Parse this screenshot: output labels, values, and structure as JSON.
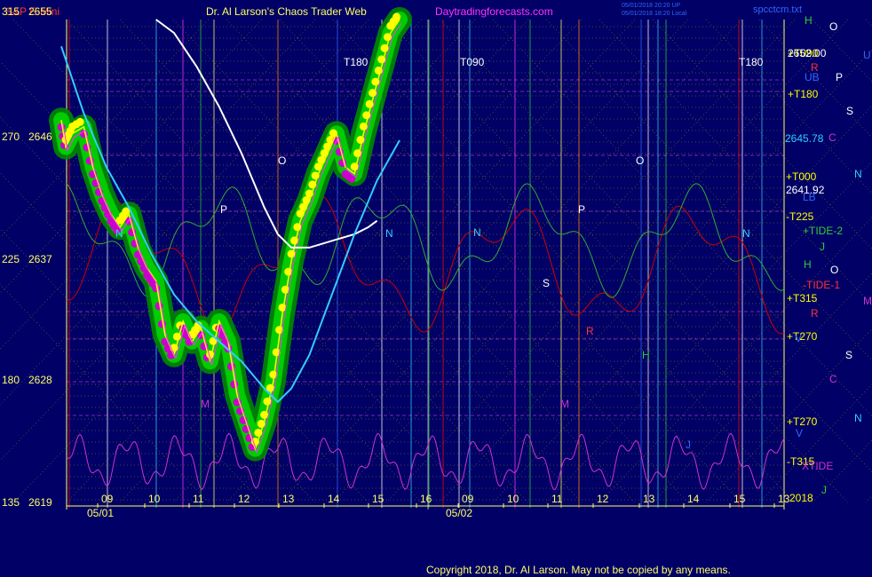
{
  "header": {
    "symbol": "S&P E-Mini",
    "title": "Dr. Al Larson's Chaos Trader Web",
    "site": "Daytradingforecasts.com",
    "stamp1": "05/01/2018 20:20 UP",
    "stamp2": "05/01/2018 18:20 Local",
    "file": "spcctcm.txt"
  },
  "footer": {
    "copyright": "Copyright 2018, Dr. Al Larson. May not be copied by any means."
  },
  "colors": {
    "background": "#000066",
    "price_body": "#00cc00",
    "up_marker": "#ffff00",
    "down_marker": "#cc00cc",
    "price_line": "#ffff00",
    "avg_white": "#ffffff",
    "avg_cyan": "#33ccff",
    "red_cycle": "#cc0000",
    "green_cycle": "#33aa33",
    "xtide": "#cc33cc",
    "grid_dots": "#cccc00",
    "level_purple": "#cc44cc"
  },
  "chart_data": {
    "type": "line",
    "y_left_angle": [
      "315",
      "270",
      "225",
      "180",
      "135"
    ],
    "y_left_price": [
      "2655",
      "2646",
      "2637",
      "2628",
      "2619"
    ],
    "ylim": [
      2619,
      2655
    ],
    "x_hour_labels": [
      "09",
      "10",
      "11",
      "12",
      "13",
      "14",
      "15",
      "16",
      "09",
      "10",
      "11",
      "12",
      "13",
      "14",
      "15",
      "13"
    ],
    "x_dates": [
      "05/01",
      "05/02"
    ],
    "right_levels": [
      {
        "label": "+T090",
        "color": "#ffff00"
      },
      {
        "label": "2652.00",
        "color": "#ffffff"
      },
      {
        "label": "+T180",
        "color": "#ffff00"
      },
      {
        "label": "2645.78",
        "color": "#33ccff"
      },
      {
        "label": "+T000",
        "color": "#ffff00"
      },
      {
        "label": "2641.92",
        "color": "#ffffff"
      },
      {
        "label": "-T225",
        "color": "#ffff00"
      },
      {
        "label": "+TIDE-2",
        "color": "#33cc33"
      },
      {
        "label": "-TIDE-1",
        "color": "#ff3333"
      },
      {
        "label": "+T315",
        "color": "#ffff00"
      },
      {
        "label": "+T270",
        "color": "#ffff00"
      },
      {
        "label": "+T270",
        "color": "#ffff00"
      },
      {
        "label": "-T315",
        "color": "#ffff00"
      },
      {
        "label": "XTIDE",
        "color": "#cc33cc"
      },
      {
        "label": "2018",
        "color": "#ffff00"
      }
    ],
    "planet_letters": [
      {
        "t": "H",
        "color": "#33cc33"
      },
      {
        "t": "O",
        "color": "#ffffff"
      },
      {
        "t": "U",
        "color": "#3366ff"
      },
      {
        "t": "R",
        "color": "#ff3333"
      },
      {
        "t": "UB",
        "color": "#3366ff"
      },
      {
        "t": "P",
        "color": "#ffffff"
      },
      {
        "t": "S",
        "color": "#ffffff"
      },
      {
        "t": "C",
        "color": "#cc33cc"
      },
      {
        "t": "N",
        "color": "#33ccff"
      },
      {
        "t": "LB",
        "color": "#3366ff"
      },
      {
        "t": "J",
        "color": "#33cc33"
      },
      {
        "t": "H",
        "color": "#33cc33"
      },
      {
        "t": "O",
        "color": "#ffffff"
      },
      {
        "t": "M",
        "color": "#cc33cc"
      },
      {
        "t": "R",
        "color": "#ff3333"
      },
      {
        "t": "V",
        "color": "#3366ff"
      },
      {
        "t": "S",
        "color": "#ffffff"
      },
      {
        "t": "C",
        "color": "#cc33cc"
      },
      {
        "t": "N",
        "color": "#33ccff"
      },
      {
        "t": "V",
        "color": "#3366ff"
      },
      {
        "t": "J",
        "color": "#33cc33"
      }
    ],
    "chart_letters": [
      {
        "t": "N",
        "color": "#33ccff"
      },
      {
        "t": "P",
        "color": "#ffffff"
      },
      {
        "t": "O",
        "color": "#ffffff"
      },
      {
        "t": "M",
        "color": "#cc33cc"
      },
      {
        "t": "T180",
        "color": "#ffffff"
      },
      {
        "t": "N",
        "color": "#33ccff"
      },
      {
        "t": "T090",
        "color": "#ffffff"
      },
      {
        "t": "N",
        "color": "#33ccff"
      },
      {
        "t": "S",
        "color": "#ffffff"
      },
      {
        "t": "P",
        "color": "#ffffff"
      },
      {
        "t": "R",
        "color": "#ff3333"
      },
      {
        "t": "M",
        "color": "#cc33cc"
      },
      {
        "t": "O",
        "color": "#ffffff"
      },
      {
        "t": "H",
        "color": "#33cc33"
      },
      {
        "t": "T180",
        "color": "#ffffff"
      },
      {
        "t": "N",
        "color": "#33ccff"
      },
      {
        "t": "J",
        "color": "#3366ff"
      }
    ],
    "price_x_hours": [
      8.5,
      8.6,
      8.75,
      9.0,
      9.2,
      9.4,
      9.6,
      9.8,
      10.0,
      10.2,
      10.4,
      10.6,
      10.8,
      11.0,
      11.2,
      11.4,
      11.6,
      11.8,
      12.0,
      12.2,
      12.4,
      12.6,
      12.8,
      13.0,
      13.2,
      13.4,
      13.6,
      13.8,
      14.0,
      14.2,
      14.4,
      14.6,
      14.8,
      15.0,
      15.2,
      15.4,
      15.6,
      15.8,
      16.0
    ],
    "price_values": [
      2647.5,
      2645.5,
      2646.5,
      2647.0,
      2644.0,
      2642.0,
      2640.5,
      2639.5,
      2640.5,
      2638.0,
      2636.5,
      2635.5,
      2631.5,
      2630.0,
      2632.5,
      2631.0,
      2632.0,
      2629.5,
      2632.5,
      2631.0,
      2627.0,
      2625.0,
      2623.0,
      2625.0,
      2628.0,
      2633.0,
      2637.0,
      2640.0,
      2641.5,
      2643.5,
      2645.0,
      2646.5,
      2644.0,
      2643.5,
      2646.5,
      2649.0,
      2651.5,
      2654.0,
      2655.0
    ],
    "white_avg_x_hours": [
      10.6,
      11.0,
      11.5,
      12.0,
      12.5,
      13.0,
      13.3,
      13.6,
      14.0,
      14.5,
      15.0,
      15.3,
      15.5
    ],
    "white_avg_values": [
      2655.0,
      2654.0,
      2651.5,
      2648.5,
      2645.0,
      2641.0,
      2639.0,
      2638.0,
      2638.0,
      2638.5,
      2639.0,
      2639.5,
      2640.0
    ],
    "cyan_avg_x_hours": [
      8.5,
      9.0,
      9.5,
      10.0,
      10.5,
      11.0,
      11.5,
      12.0,
      12.5,
      13.0,
      13.3,
      13.6,
      14.0,
      14.5,
      15.0,
      15.5,
      16.0
    ],
    "cyan_avg_values": [
      2653.0,
      2648.0,
      2644.0,
      2641.0,
      2637.5,
      2634.5,
      2632.5,
      2631.0,
      2629.5,
      2627.5,
      2626.5,
      2627.5,
      2630.0,
      2634.5,
      2639.0,
      2643.0,
      2646.0
    ]
  }
}
